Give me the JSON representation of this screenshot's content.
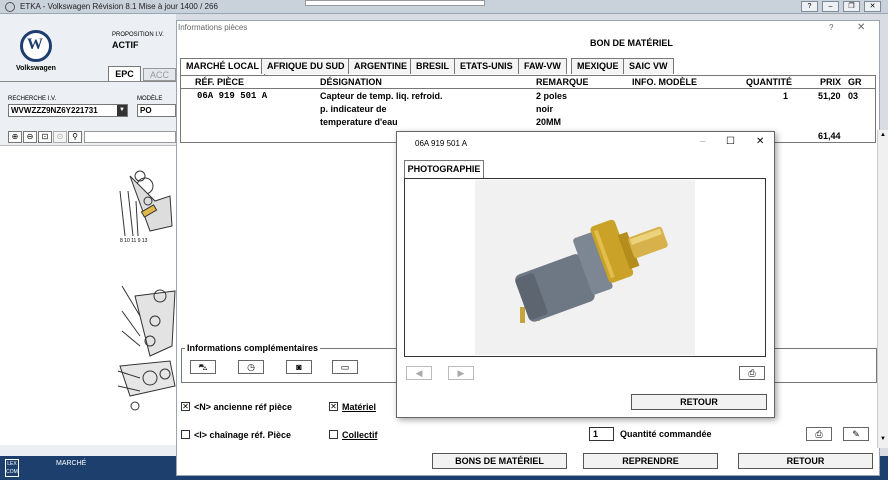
{
  "titlebar": {
    "title": "ETKA - Volkswagen Révision 8.1 Mise à jour 1400 / 266"
  },
  "left": {
    "brand": "Volkswagen",
    "proposition_label": "PROPOSITION I.V.",
    "proposition_value": "ACTIF",
    "tab_epc": "EPC",
    "tab_acc": "ACC",
    "search_label": "RECHERCHE I.V.",
    "search_value": "WVWZZZ9NZ6Y221731",
    "model_label": "MODÈLE",
    "model_value": "PO",
    "bottom_label": "MARCHÉ",
    "lexcom": "LEX COM"
  },
  "main": {
    "window_title": "Informations pièces",
    "bon_title": "BON DE MATÉRIEL",
    "tabs": [
      "MARCHÉ LOCAL",
      "AFRIQUE DU SUD",
      "ARGENTINE",
      "BRESIL",
      "ETATS-UNIS",
      "FAW-VW",
      "MEXIQUE",
      "SAIC VW"
    ],
    "columns": {
      "ref": "RÉF. PIÈCE",
      "designation": "DÉSIGNATION",
      "remarque": "REMARQUE",
      "info": "INFO. MODÈLE",
      "quantite": "QUANTITÉ",
      "prix": "PRIX",
      "gr": "GR"
    },
    "row": {
      "ref": "06A 919 501 A",
      "designation_1": "Capteur de temp. liq. refroid.",
      "designation_2": "p. indicateur de",
      "designation_3": "temperature d'eau",
      "remarque_1": "2 poles",
      "remarque_2": "noir",
      "remarque_3": "20MM",
      "quantite": "1",
      "prix": "51,20",
      "gr": "03",
      "total": "61,44"
    },
    "info_comp_label": "Informations complémentaires",
    "chk_ancienne": "<N> ancienne réf pièce",
    "chk_materiel": "Matériel",
    "chk_chainage": "<I> chaînage réf. Pièce",
    "chk_collectif": "Collectif",
    "qty_value": "1",
    "qty_label": "Quantité commandée",
    "btn_bons": "BONS DE MATÉRIEL",
    "btn_reprendre": "REPRENDRE",
    "btn_retour": "RETOUR"
  },
  "photo": {
    "title": "06A 919 501 A",
    "tab": "PHOTOGRAPHIE",
    "btn_retour": "RETOUR"
  },
  "colors": {
    "accent_blue": "#1c3f6e",
    "brass": "#c9a227",
    "sensor_grey": "#7d8793"
  }
}
